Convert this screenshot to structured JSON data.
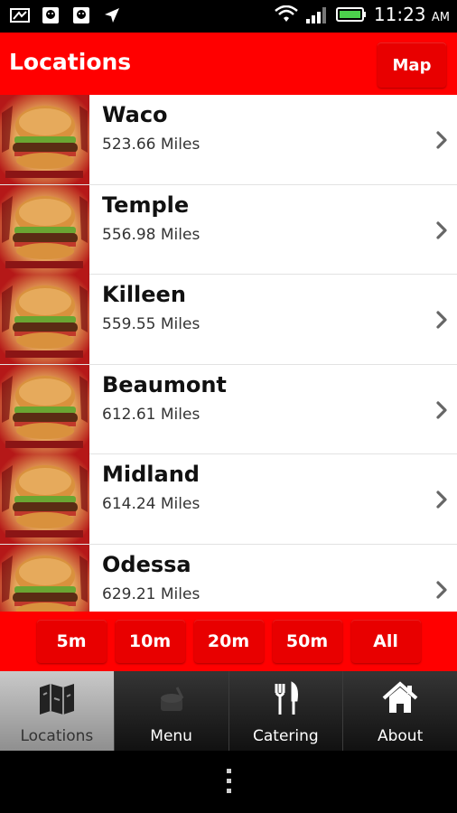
{
  "statusbar": {
    "time": "11:23",
    "ampm": "AM"
  },
  "header": {
    "title": "Locations",
    "map_label": "Map"
  },
  "locations": [
    {
      "name": "Waco",
      "distance": "523.66 Miles"
    },
    {
      "name": "Temple",
      "distance": "556.98 Miles"
    },
    {
      "name": "Killeen",
      "distance": "559.55 Miles"
    },
    {
      "name": "Beaumont",
      "distance": "612.61 Miles"
    },
    {
      "name": "Midland",
      "distance": "614.24 Miles"
    },
    {
      "name": "Odessa",
      "distance": "629.21 Miles"
    }
  ],
  "filters": [
    "5m",
    "10m",
    "20m",
    "50m",
    "All"
  ],
  "tabs": [
    {
      "label": "Locations",
      "icon": "map-icon",
      "active": true
    },
    {
      "label": "Menu",
      "icon": "food-icon",
      "active": false
    },
    {
      "label": "Catering",
      "icon": "fork-knife-icon",
      "active": false
    },
    {
      "label": "About",
      "icon": "home-icon",
      "active": false
    }
  ],
  "colors": {
    "brand_red": "#ff0000",
    "button_red": "#e80000",
    "tab_dark": "#1a1a1a",
    "tab_active": "#b0b0b0"
  }
}
